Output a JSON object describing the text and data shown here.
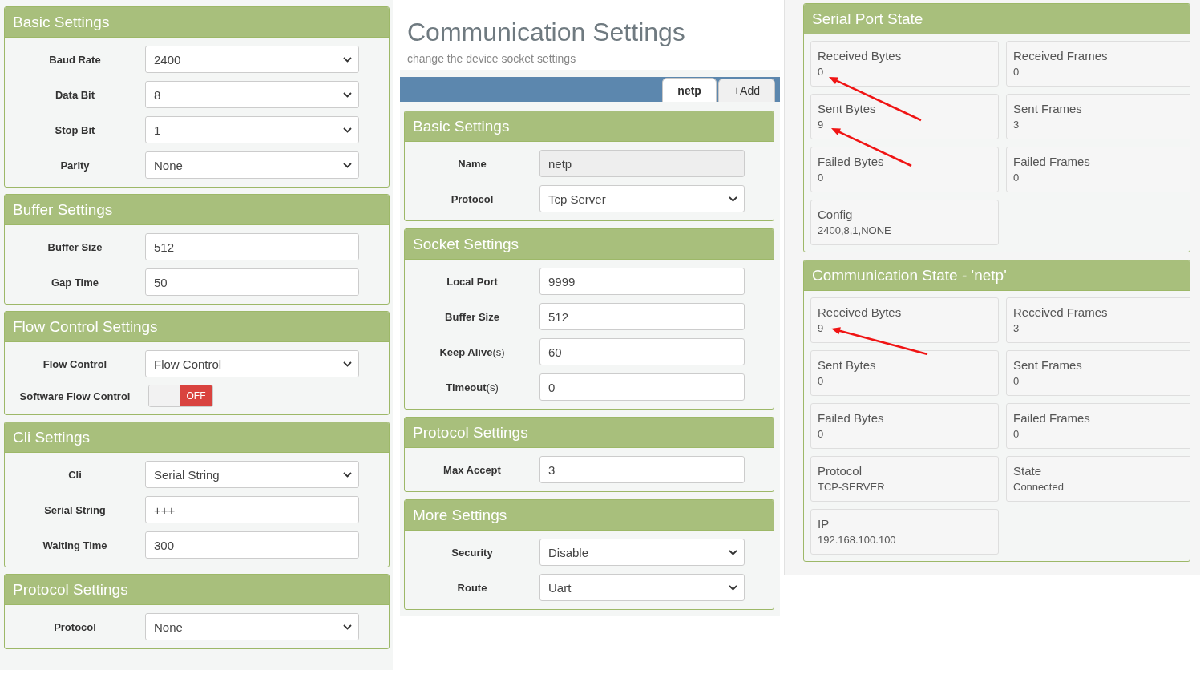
{
  "left_panels": [
    {
      "title": "Basic Settings",
      "fields": [
        {
          "kind": "select",
          "label": "Baud Rate",
          "value": "2400"
        },
        {
          "kind": "select",
          "label": "Data Bit",
          "value": "8"
        },
        {
          "kind": "select",
          "label": "Stop Bit",
          "value": "1"
        },
        {
          "kind": "select",
          "label": "Parity",
          "value": "None"
        }
      ]
    },
    {
      "title": "Buffer Settings",
      "fields": [
        {
          "kind": "input",
          "label": "Buffer Size",
          "value": "512"
        },
        {
          "kind": "input",
          "label": "Gap Time",
          "value": "50"
        }
      ]
    },
    {
      "title": "Flow Control Settings",
      "fields": [
        {
          "kind": "select",
          "label": "Flow Control",
          "value": "Flow Control"
        },
        {
          "kind": "toggle",
          "label": "Software Flow Control",
          "on": false,
          "state_text": "OFF"
        }
      ]
    },
    {
      "title": "Cli Settings",
      "fields": [
        {
          "kind": "select",
          "label": "Cli",
          "value": "Serial String"
        },
        {
          "kind": "input",
          "label": "Serial String",
          "value": "+++"
        },
        {
          "kind": "input",
          "label": "Waiting Time",
          "value": "300"
        }
      ]
    },
    {
      "title": "Protocol Settings",
      "fields": [
        {
          "kind": "select",
          "label": "Protocol",
          "value": "None"
        }
      ]
    }
  ],
  "header": {
    "title": "Communication Settings",
    "subtitle": "change the device socket settings"
  },
  "tabs": [
    {
      "label": "netp",
      "selected": true
    },
    {
      "label": "+Add",
      "selected": false
    }
  ],
  "middle_panels": [
    {
      "title": "Basic Settings",
      "fields": [
        {
          "kind": "readonly",
          "label": "Name",
          "value": "netp"
        },
        {
          "kind": "select",
          "label": "Protocol",
          "value": "Tcp Server"
        }
      ]
    },
    {
      "title": "Socket Settings",
      "fields": [
        {
          "kind": "input",
          "label": "Local Port",
          "value": "9999"
        },
        {
          "kind": "input",
          "label": "Buffer Size",
          "value": "512"
        },
        {
          "kind": "input",
          "label": "Keep Alive",
          "unit": "(s)",
          "value": "60"
        },
        {
          "kind": "input",
          "label": "Timeout",
          "unit": "(s)",
          "value": "0"
        }
      ]
    },
    {
      "title": "Protocol Settings",
      "fields": [
        {
          "kind": "input",
          "label": "Max Accept",
          "value": "3"
        }
      ]
    },
    {
      "title": "More Settings",
      "fields": [
        {
          "kind": "select",
          "label": "Security",
          "value": "Disable"
        },
        {
          "kind": "select",
          "label": "Route",
          "value": "Uart"
        }
      ]
    }
  ],
  "state_panels": [
    {
      "title": "Serial Port State",
      "cells": [
        {
          "label": "Received Bytes",
          "value": "0"
        },
        {
          "label": "Received Frames",
          "value": "0"
        },
        {
          "label": "Sent Bytes",
          "value": "9"
        },
        {
          "label": "Sent Frames",
          "value": "3"
        },
        {
          "label": "Failed Bytes",
          "value": "0"
        },
        {
          "label": "Failed Frames",
          "value": "0"
        },
        {
          "label": "Config",
          "value": "2400,8,1,NONE"
        }
      ]
    },
    {
      "title": "Communication State - 'netp'",
      "cells": [
        {
          "label": "Received Bytes",
          "value": "9"
        },
        {
          "label": "Received Frames",
          "value": "3"
        },
        {
          "label": "Sent Bytes",
          "value": "0"
        },
        {
          "label": "Sent Frames",
          "value": "0"
        },
        {
          "label": "Failed Bytes",
          "value": "0"
        },
        {
          "label": "Failed Frames",
          "value": "0"
        },
        {
          "label": "Protocol",
          "value": "TCP-SERVER"
        },
        {
          "label": "State",
          "value": "Connected"
        },
        {
          "label": "IP",
          "value": "192.168.100.100"
        }
      ]
    }
  ]
}
